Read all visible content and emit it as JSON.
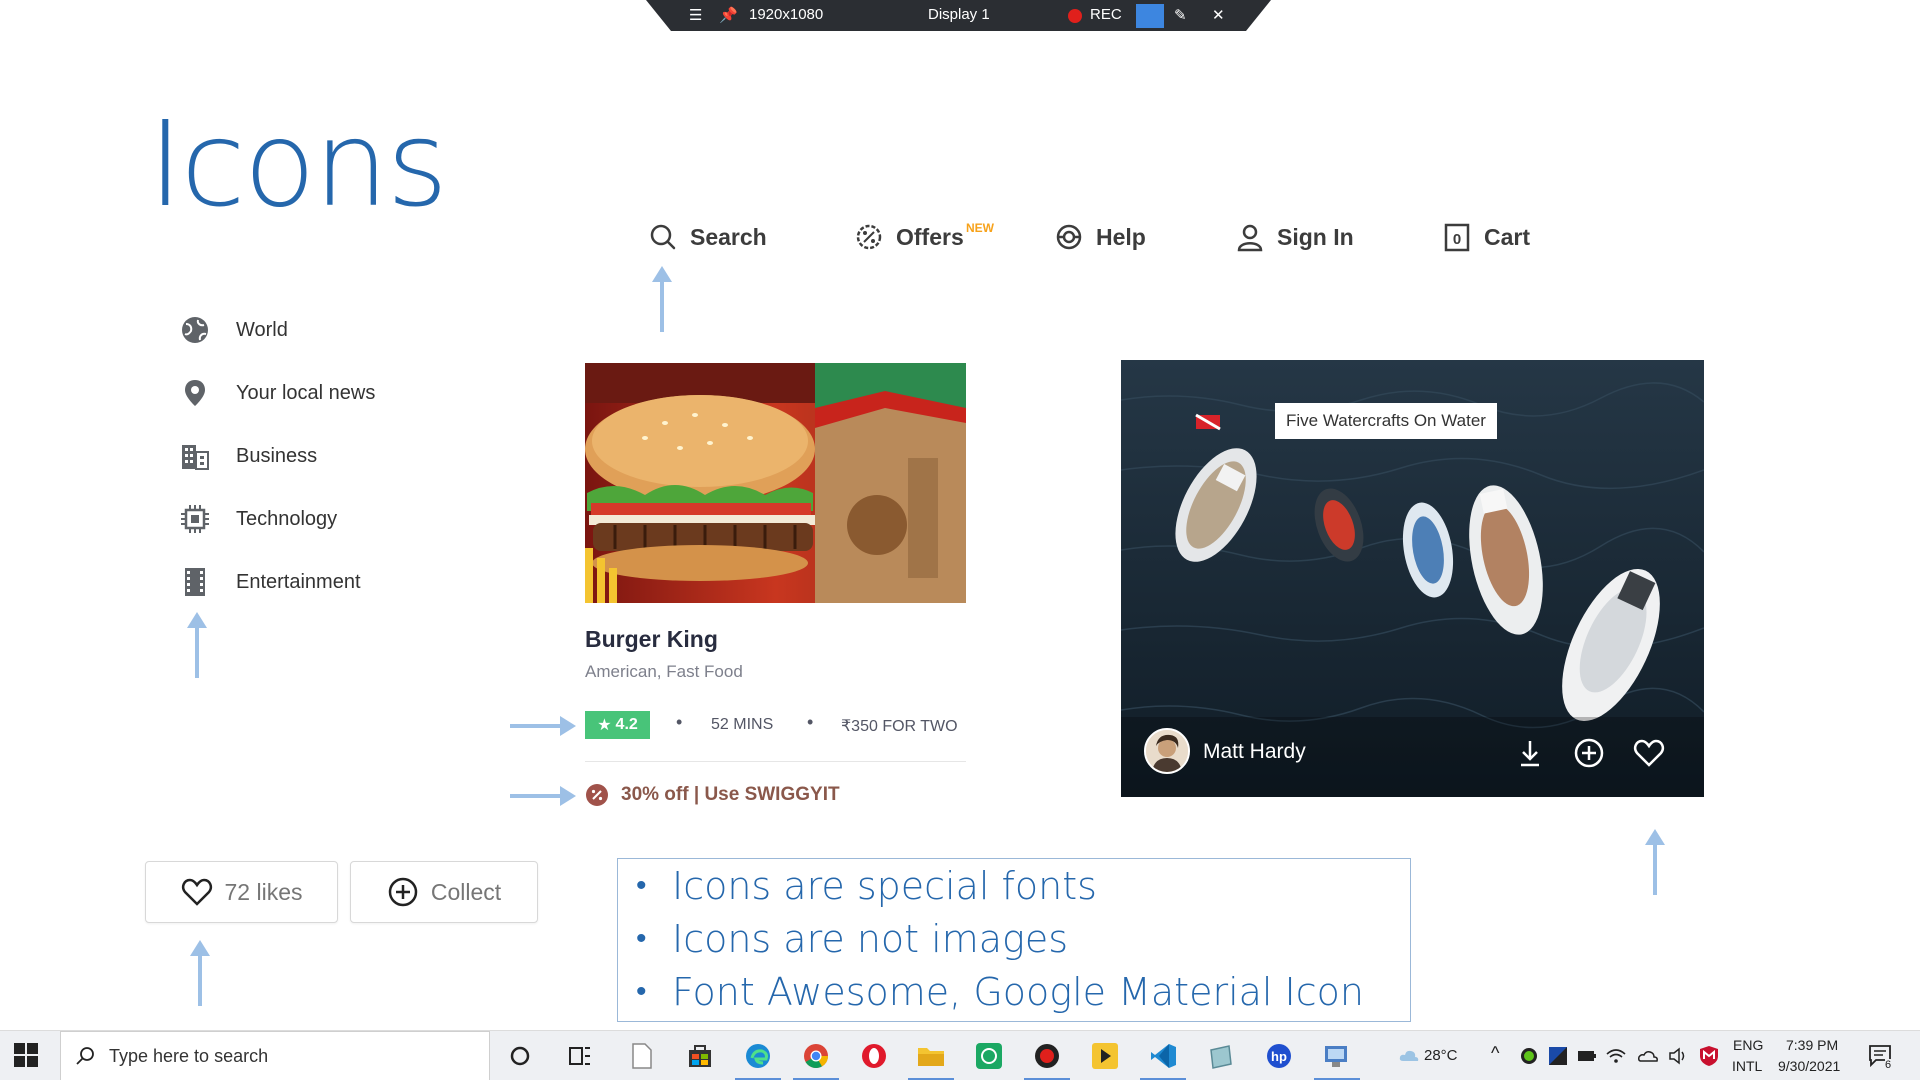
{
  "recorder": {
    "resolution": "1920x1080",
    "display": "Display 1",
    "rec_label": "REC"
  },
  "slide": {
    "title": "Icons"
  },
  "top_nav": {
    "items": [
      {
        "label": "Search",
        "icon": "search-icon"
      },
      {
        "label": "Offers",
        "icon": "offers-icon",
        "badge": "NEW"
      },
      {
        "label": "Help",
        "icon": "help-icon"
      },
      {
        "label": "Sign In",
        "icon": "user-icon"
      },
      {
        "label": "Cart",
        "icon": "cart-icon",
        "count": "0"
      }
    ]
  },
  "sidebar": {
    "items": [
      {
        "label": "World",
        "icon": "globe-icon"
      },
      {
        "label": "Your local news",
        "icon": "location-pin-icon"
      },
      {
        "label": "Business",
        "icon": "building-icon"
      },
      {
        "label": "Technology",
        "icon": "chip-icon"
      },
      {
        "label": "Entertainment",
        "icon": "film-icon"
      }
    ]
  },
  "food_card": {
    "name": "Burger King",
    "cuisine": "American, Fast Food",
    "rating": "4.2",
    "time": "52 MINS",
    "price": "₹350 FOR TWO",
    "offer": "30% off | Use SWIGGYIT",
    "rating_color": "#48c479"
  },
  "photo_card": {
    "caption": "Five Watercrafts On Water",
    "author": "Matt Hardy"
  },
  "buttons": {
    "likes": "72 likes",
    "collect": "Collect"
  },
  "bullets": [
    "Icons are special fonts",
    "Icons are not images",
    "Font Awesome, Google Material Icon"
  ],
  "taskbar": {
    "search_placeholder": "Type here to search",
    "weather": "28°C",
    "language": "ENG",
    "layout": "INTL",
    "time": "7:39 PM",
    "date": "9/30/2021",
    "notifications": "6"
  },
  "colors": {
    "title_blue": "#2567ac",
    "arrow_blue": "#9dc0e6",
    "badge_orange": "#f7a21a"
  }
}
